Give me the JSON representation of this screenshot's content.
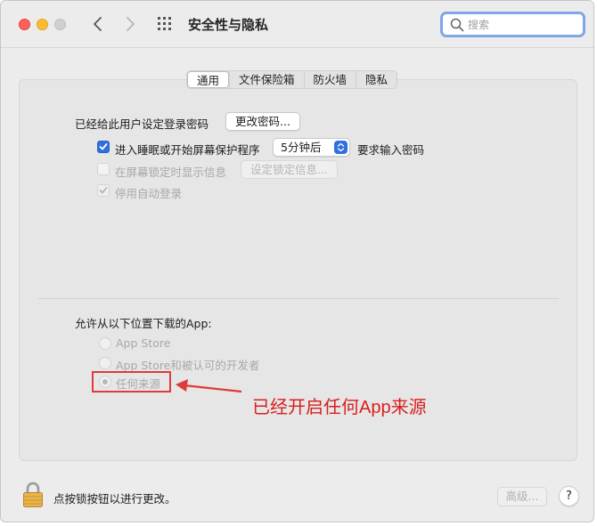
{
  "window": {
    "title": "安全性与隐私"
  },
  "toolbar": {
    "back_icon": "chevron-left-icon",
    "forward_icon": "chevron-right-icon",
    "grid_icon": "grid-icon"
  },
  "search": {
    "placeholder": "搜索"
  },
  "tabs": [
    {
      "label": "通用",
      "active": true
    },
    {
      "label": "文件保险箱",
      "active": false
    },
    {
      "label": "防火墙",
      "active": false
    },
    {
      "label": "隐私",
      "active": false
    }
  ],
  "general": {
    "password_label": "已经给此用户设定登录密码",
    "change_password_button": "更改密码...",
    "require_password": {
      "checked": true,
      "label": "进入睡眠或开始屏幕保护程序",
      "select_value": "5分钟后",
      "suffix": "要求输入密码"
    },
    "lock_message": {
      "checked": false,
      "label": "在屏幕锁定时显示信息",
      "button": "设定锁定信息..."
    },
    "disable_auto_login": {
      "checked": true,
      "label": "停用自动登录"
    }
  },
  "gatekeeper": {
    "heading": "允许从以下位置下载的App:",
    "options": [
      {
        "label": "App Store",
        "selected": false
      },
      {
        "label": "App Store和被认可的开发者",
        "selected": false
      },
      {
        "label": "任何来源",
        "selected": true
      }
    ]
  },
  "annotation": {
    "text": "已经开启任何App来源",
    "color": "#d91e1e"
  },
  "footer": {
    "lock_text": "点按锁按钮以进行更改。",
    "advanced_button": "高级...",
    "help_button": "?"
  },
  "colors": {
    "accent": "#2f6fe0",
    "close": "#fe5f57",
    "minimize": "#febc2e"
  }
}
